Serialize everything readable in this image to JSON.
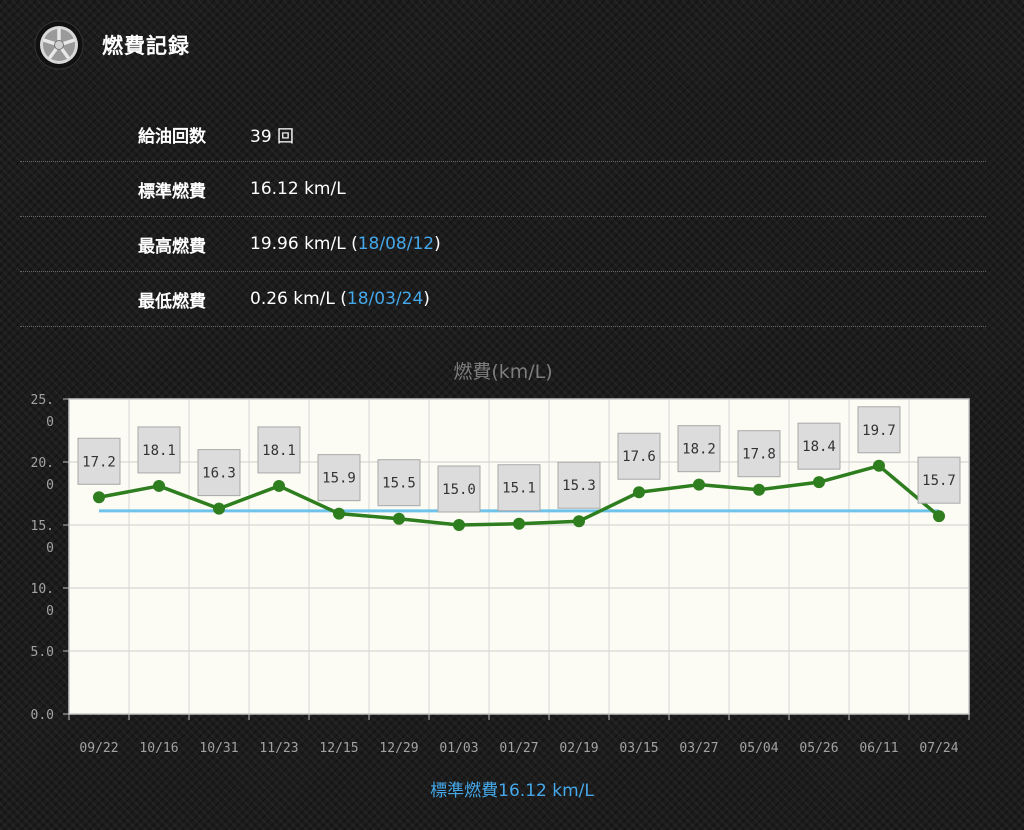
{
  "page": {
    "title": "燃費記録",
    "stats": [
      {
        "label": "給油回数",
        "value": "39 回",
        "date": ""
      },
      {
        "label": "標準燃費",
        "value": "16.12 km/L",
        "date": ""
      },
      {
        "label": "最高燃費",
        "value": "19.96 km/L (",
        "date": "18/08/12",
        "suffix": ")"
      },
      {
        "label": "最低燃費",
        "value": "0.26 km/L (",
        "date": "18/03/24",
        "suffix": ")"
      }
    ],
    "footer": "標準燃費16.12 km/L"
  },
  "chart_data": {
    "type": "line",
    "title": "燃費(km/L)",
    "categories": [
      "09/22",
      "10/16",
      "10/31",
      "11/23",
      "12/15",
      "12/29",
      "01/03",
      "01/27",
      "02/19",
      "03/15",
      "03/27",
      "05/04",
      "05/26",
      "06/11",
      "07/24"
    ],
    "series": [
      {
        "values": [
          17.2,
          18.1,
          16.3,
          18.1,
          15.9,
          15.5,
          15.0,
          15.1,
          15.3,
          17.6,
          18.2,
          17.8,
          18.4,
          19.7,
          15.7
        ],
        "color": "#2e7d1e"
      }
    ],
    "reference_line": {
      "value": 16.12,
      "color": "#6ec3ea"
    },
    "ylim": [
      0,
      25
    ],
    "y_ticks": [
      {
        "value": 0,
        "label": "0.0"
      },
      {
        "value": 5,
        "label": "5.0"
      },
      {
        "value": 10,
        "label": "10.\n0"
      },
      {
        "value": 15,
        "label": "15.\n0"
      },
      {
        "value": 20,
        "label": "20.\n0"
      },
      {
        "value": 25,
        "label": "25.\n0"
      }
    ],
    "grid": true
  }
}
